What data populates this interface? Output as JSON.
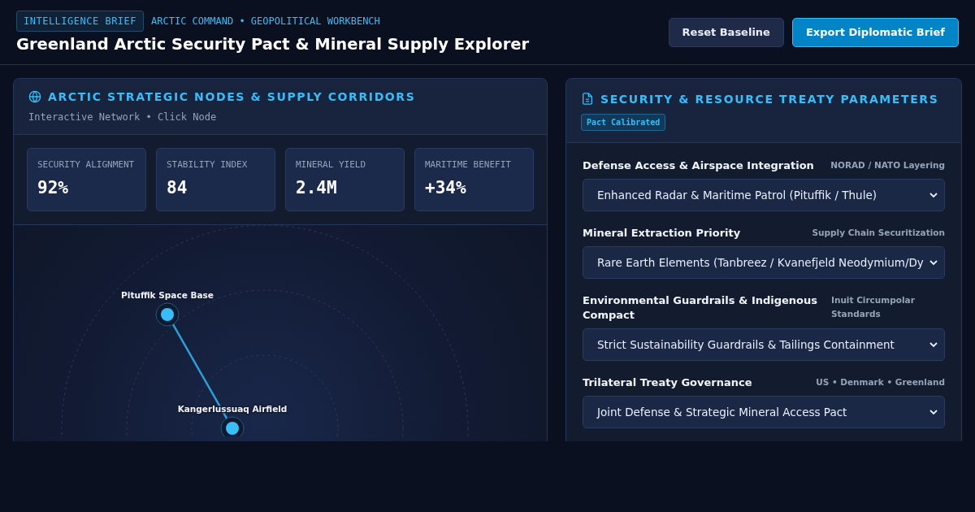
{
  "header": {
    "badge": "INTELLIGENCE BRIEF",
    "breadcrumb": "ARCTIC COMMAND • GEOPOLITICAL WORKBENCH",
    "title": "Greenland Arctic Security Pact & Mineral Supply Explorer",
    "buttons": [
      {
        "label": "Reset Baseline",
        "kind": "secondary"
      },
      {
        "label": "Export Diplomatic Brief",
        "kind": "primary"
      }
    ]
  },
  "network_panel": {
    "title": "ARCTIC STRATEGIC NODES & SUPPLY CORRIDORS",
    "subtitle": "Interactive Network • Click Node",
    "stats": [
      {
        "label": "SECURITY ALIGNMENT",
        "value": "92%"
      },
      {
        "label": "STABILITY INDEX",
        "value": "84"
      },
      {
        "label": "MINERAL YIELD",
        "value": "2.4M"
      },
      {
        "label": "MARITIME BENEFIT",
        "value": "+34%"
      }
    ],
    "nodes": [
      {
        "label": "Pituffik Space Base"
      },
      {
        "label": "Kangerlussuaq Airfield"
      }
    ]
  },
  "treaty_panel": {
    "title": "SECURITY & RESOURCE TREATY PARAMETERS",
    "badge": "Pact Calibrated",
    "fields": [
      {
        "label": "Defense Access & Airspace Integration",
        "hint": "NORAD / NATO Layering",
        "value": "Enhanced Radar & Maritime Patrol (Pituffik / Thule)"
      },
      {
        "label": "Mineral Extraction Priority",
        "hint": "Supply Chain Securitization",
        "value": "Rare Earth Elements (Tanbreez / Kvanefjeld Neodymium/Dy"
      },
      {
        "label": "Environmental Guardrails & Indigenous Compact",
        "hint": "Inuit Circumpolar Standards",
        "value": "Strict Sustainability Guardrails & Tailings Containment"
      },
      {
        "label": "Trilateral Treaty Governance",
        "hint": "US • Denmark • Greenland",
        "value": "Joint Defense & Strategic Mineral Access Pact"
      }
    ]
  }
}
